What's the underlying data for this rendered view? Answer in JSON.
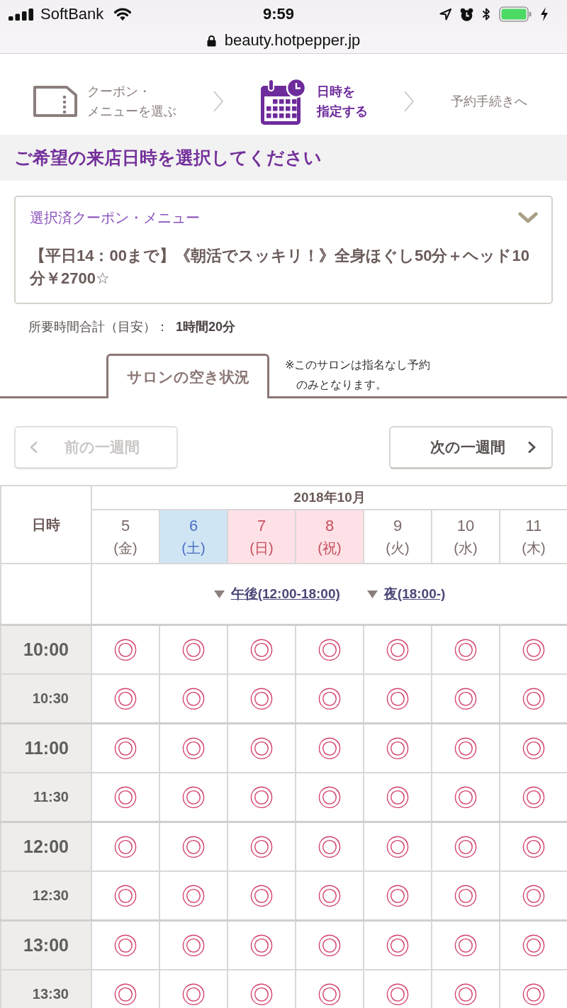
{
  "status_bar": {
    "carrier": "SoftBank",
    "time": "9:59"
  },
  "address_bar": {
    "url": "beauty.hotpepper.jp"
  },
  "steps": [
    {
      "kind": "coupon",
      "lines": [
        "クーポン・",
        "メニューを選ぶ"
      ],
      "selected": false
    },
    {
      "kind": "datetime",
      "lines": [
        "日時を",
        "指定する"
      ],
      "selected": true
    },
    {
      "kind": "checkout",
      "lines": [
        "予約手続きへ"
      ],
      "selected": false
    }
  ],
  "heading": "ご希望の来店日時を選択してください",
  "coupon_card": {
    "title": "選択済クーポン・メニュー",
    "text": "【平日14：00まで】《朝活でスッキリ！》全身ほぐし50分＋ヘッド10分￥2700☆"
  },
  "duration": {
    "label": "所要時間合計（目安）：",
    "value": "1時間20分"
  },
  "tabs": [
    {
      "label": "サロンの空き状況",
      "selected": true
    }
  ],
  "tab_note": "※このサロンは指名なし予約のみとなります。",
  "week_nav": [
    {
      "kind": "prev",
      "label": "前の一週間",
      "disabled": true
    },
    {
      "kind": "next",
      "label": "次の一週間",
      "disabled": false
    }
  ],
  "schedule": {
    "corner_label": "日時",
    "month": "2018年10月",
    "days": [
      {
        "date": "5",
        "weekday": "(金)",
        "kind": "weekday"
      },
      {
        "date": "6",
        "weekday": "(土)",
        "kind": "saturday"
      },
      {
        "date": "7",
        "weekday": "(日)",
        "kind": "sunday"
      },
      {
        "date": "8",
        "weekday": "(祝)",
        "kind": "holiday"
      },
      {
        "date": "9",
        "weekday": "(火)",
        "kind": "weekday"
      },
      {
        "date": "10",
        "weekday": "(水)",
        "kind": "weekday"
      },
      {
        "date": "11",
        "weekday": "(木)",
        "kind": "weekday"
      }
    ],
    "periods": [
      "午後(12:00-18:00)",
      "夜(18:00-)"
    ],
    "rows": [
      {
        "time": "10:00",
        "kind": "hour",
        "slots": [
          "◎",
          "◎",
          "◎",
          "◎",
          "◎",
          "◎",
          "◎"
        ]
      },
      {
        "time": "10:30",
        "kind": "half_hour",
        "slots": [
          "◎",
          "◎",
          "◎",
          "◎",
          "◎",
          "◎",
          "◎"
        ]
      },
      {
        "time": "11:00",
        "kind": "hour",
        "slots": [
          "◎",
          "◎",
          "◎",
          "◎",
          "◎",
          "◎",
          "◎"
        ]
      },
      {
        "time": "11:30",
        "kind": "half_hour",
        "slots": [
          "◎",
          "◎",
          "◎",
          "◎",
          "◎",
          "◎",
          "◎"
        ]
      },
      {
        "time": "12:00",
        "kind": "hour",
        "slots": [
          "◎",
          "◎",
          "◎",
          "◎",
          "◎",
          "◎",
          "◎"
        ]
      },
      {
        "time": "12:30",
        "kind": "half_hour",
        "slots": [
          "◎",
          "◎",
          "◎",
          "◎",
          "◎",
          "◎",
          "◎"
        ]
      },
      {
        "time": "13:00",
        "kind": "hour",
        "slots": [
          "◎",
          "◎",
          "◎",
          "◎",
          "◎",
          "◎",
          "◎"
        ]
      },
      {
        "time": "13:30",
        "kind": "half_hour",
        "slots": [
          "◎",
          "◎",
          "◎",
          "◎",
          "◎",
          "◎",
          "◎"
        ]
      }
    ]
  }
}
